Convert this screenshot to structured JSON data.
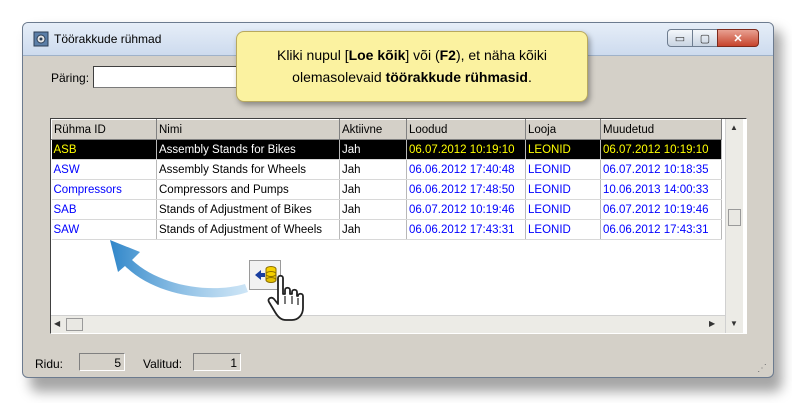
{
  "window": {
    "title": "Töörakkude rühmad",
    "buttons": {
      "minimize": "▭",
      "maximize": "▢",
      "close": "✕"
    }
  },
  "query": {
    "label": "Päring:",
    "value": ""
  },
  "tooltip": {
    "line1_pre": "Kliki nupul [",
    "line1_bold1": "Loe kõik",
    "line1_mid": "] või (",
    "line1_bold2": "F2",
    "line1_post": "), et näha kõiki",
    "line2_pre": "olemasolevaid ",
    "line2_bold": "töörakkude rühmasid",
    "line2_post": "."
  },
  "table": {
    "columns": [
      "Rühma ID",
      "Nimi",
      "Aktiivne",
      "Loodud",
      "Looja",
      "Muudetud"
    ],
    "rows": [
      [
        "ASB",
        "Assembly Stands for Bikes",
        "Jah",
        "06.07.2012 10:19:10",
        "LEONID",
        "06.07.2012 10:19:10"
      ],
      [
        "ASW",
        "Assembly Stands for Wheels",
        "Jah",
        "06.06.2012 17:40:48",
        "LEONID",
        "06.07.2012 10:18:35"
      ],
      [
        "Compressors",
        "Compressors and Pumps",
        "Jah",
        "06.06.2012 17:48:50",
        "LEONID",
        "10.06.2013 14:00:33"
      ],
      [
        "SAB",
        "Stands of Adjustment of Bikes",
        "Jah",
        "06.07.2012 10:19:46",
        "LEONID",
        "06.07.2012 10:19:46"
      ],
      [
        "SAW",
        "Stands of Adjustment of Wheels",
        "Jah",
        "06.06.2012 17:43:31",
        "LEONID",
        "06.06.2012 17:43:31"
      ]
    ],
    "selected_row": 0
  },
  "status": {
    "rows_label": "Ridu:",
    "rows_value": "5",
    "selected_label": "Valitud:",
    "selected_value": "1"
  },
  "colors": {
    "link_blue": "#0000ff",
    "selected_bg": "#000000",
    "selected_highlight": "#ffff00",
    "tooltip_bg": "#fbf2a0",
    "arrow_blue": "#4a9fd8"
  },
  "icons": [
    "app-icon",
    "load-all-icon",
    "pointer-hand-icon",
    "curved-arrow-icon"
  ]
}
